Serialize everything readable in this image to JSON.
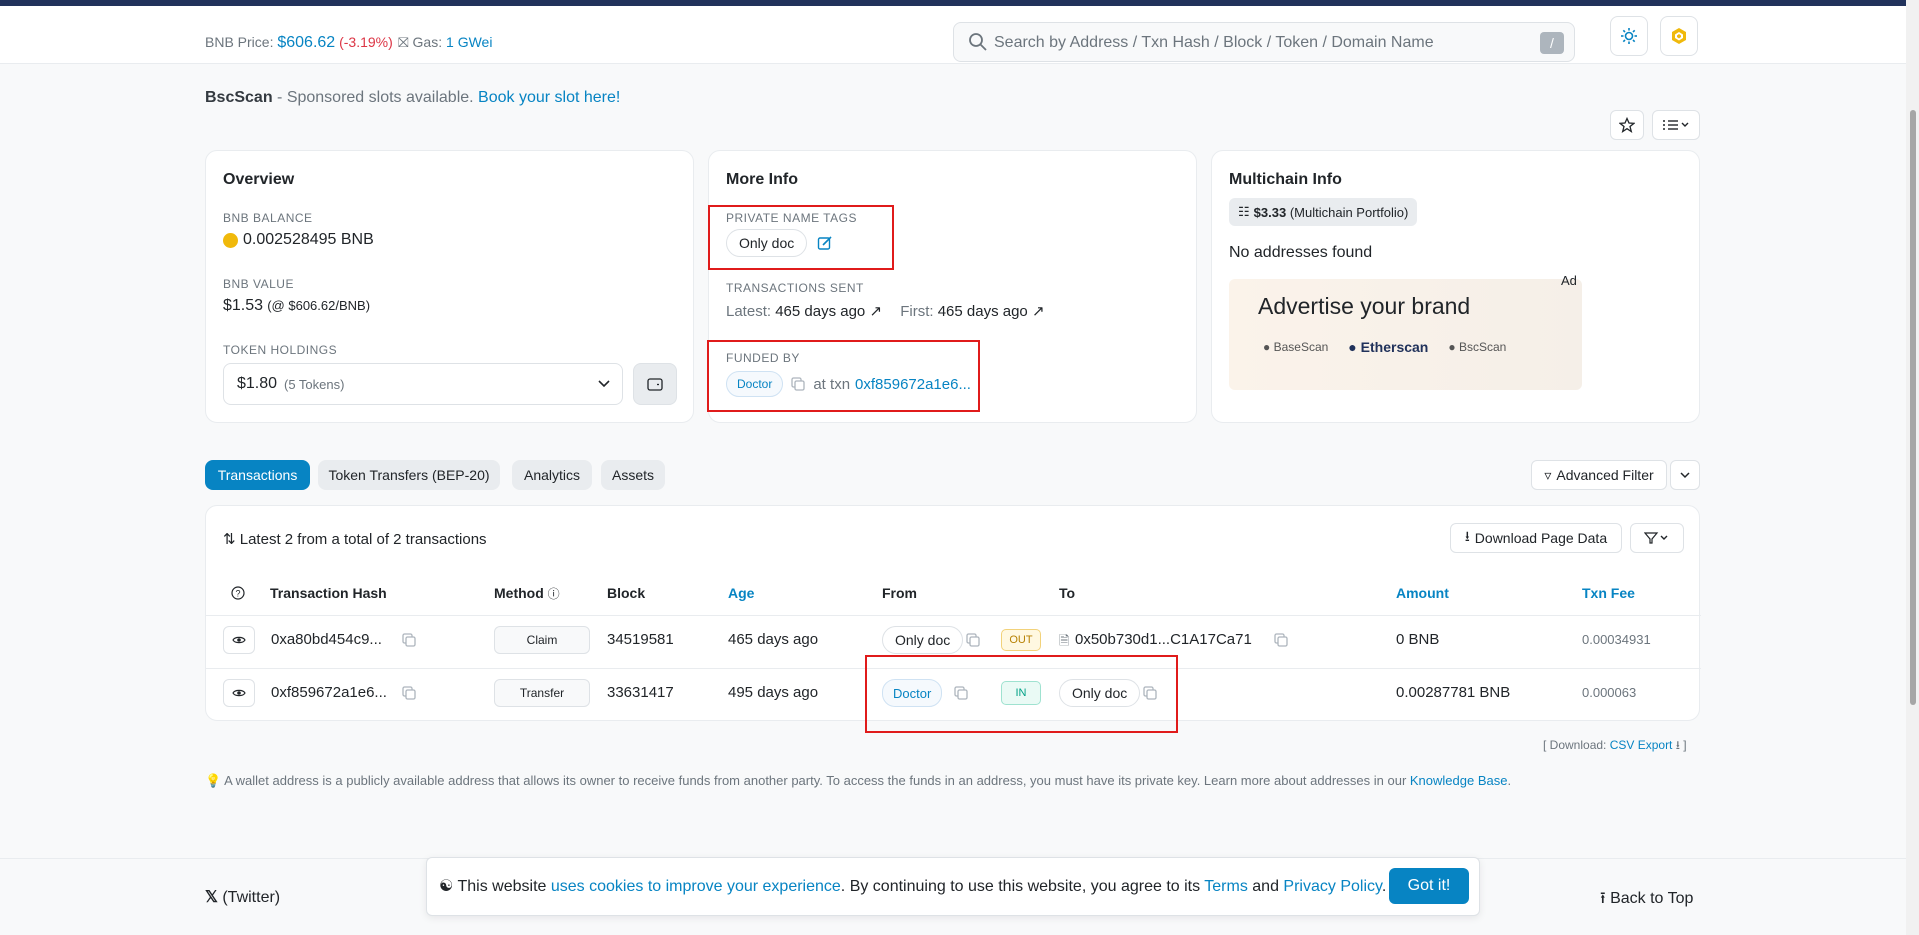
{
  "header": {
    "bnb_price_label": "BNB Price:",
    "bnb_price_value": "$606.62",
    "bnb_price_change": "(-3.19%)",
    "gas_label": "Gas:",
    "gas_value": "1 GWei",
    "search_placeholder": "Search by Address / Txn Hash / Block / Token / Domain Name",
    "search_shortcut": "/"
  },
  "sponsor": {
    "brand": "BscScan",
    "text": " - Sponsored slots available. ",
    "link": "Book your slot here!"
  },
  "overview": {
    "title": "Overview",
    "bnb_balance_label": "BNB BALANCE",
    "bnb_balance_value": "0.002528495 BNB",
    "bnb_value_label": "BNB VALUE",
    "bnb_value_value": "$1.53",
    "bnb_value_rate": "(@ $606.62/BNB)",
    "token_holdings_label": "TOKEN HOLDINGS",
    "token_holdings_value": "$1.80",
    "token_holdings_count": "(5 Tokens)"
  },
  "more_info": {
    "title": "More Info",
    "private_tags_label": "PRIVATE NAME TAGS",
    "private_tag": "Only doc",
    "tx_sent_label": "TRANSACTIONS SENT",
    "latest_label": "Latest:",
    "latest_value": "465 days ago",
    "first_label": "First:",
    "first_value": "465 days ago",
    "funded_by_label": "FUNDED BY",
    "funded_by_tag": "Doctor",
    "at_txn": "at txn",
    "funded_txn": "0xf859672a1e6..."
  },
  "multichain": {
    "title": "Multichain Info",
    "portfolio_value": "$3.33",
    "portfolio_label": "(Multichain Portfolio)",
    "no_addresses": "No addresses found",
    "ad_label": "Ad",
    "ad_headline": "Advertise your brand",
    "ad_brands": [
      "BaseScan",
      "Etherscan",
      "BscScan"
    ]
  },
  "tabs": [
    {
      "label": "Transactions",
      "active": true
    },
    {
      "label": "Token Transfers (BEP-20)",
      "active": false
    },
    {
      "label": "Analytics",
      "active": false
    },
    {
      "label": "Assets",
      "active": false
    }
  ],
  "advanced_filter": "Advanced Filter",
  "table": {
    "summary": "Latest 2 from a total of 2 transactions",
    "download": "Download Page Data",
    "headers": [
      "Transaction Hash",
      "Method",
      "Block",
      "Age",
      "From",
      "To",
      "Amount",
      "Txn Fee"
    ],
    "rows": [
      {
        "hash": "0xa80bd454c9...",
        "method": "Claim",
        "block": "34519581",
        "age": "465 days ago",
        "from": "Only doc",
        "direction": "OUT",
        "to": "0x50b730d1...C1A17Ca71",
        "amount": "0 BNB",
        "fee": "0.00034931"
      },
      {
        "hash": "0xf859672a1e6...",
        "method": "Transfer",
        "block": "33631417",
        "age": "495 days ago",
        "from": "Doctor",
        "direction": "IN",
        "to": "Only doc",
        "amount": "0.00287781 BNB",
        "fee": "0.000063"
      }
    ]
  },
  "csv": {
    "prefix": "[ Download: ",
    "link": "CSV Export",
    "suffix": " ]"
  },
  "note": {
    "text": "A wallet address is a publicly available address that allows its owner to receive funds from another party. To access the funds in an address, you must have its private key. Learn more about addresses in our ",
    "link": "Knowledge Base",
    "end": "."
  },
  "footer": {
    "twitter": "(Twitter)",
    "back_to_top": "Back to Top"
  },
  "cookie": {
    "text1": "This website ",
    "link1": "uses cookies to improve your experience",
    "text2": ". By continuing to use this website, you agree to its ",
    "link2": "Terms",
    "text3": " and ",
    "link3": "Privacy Policy",
    "text4": ".",
    "button": "Got it!"
  },
  "colors": {
    "accent": "#0784c3",
    "negative": "#dc3545",
    "highlight_box": "#e01b1b",
    "navy": "#21325b"
  }
}
